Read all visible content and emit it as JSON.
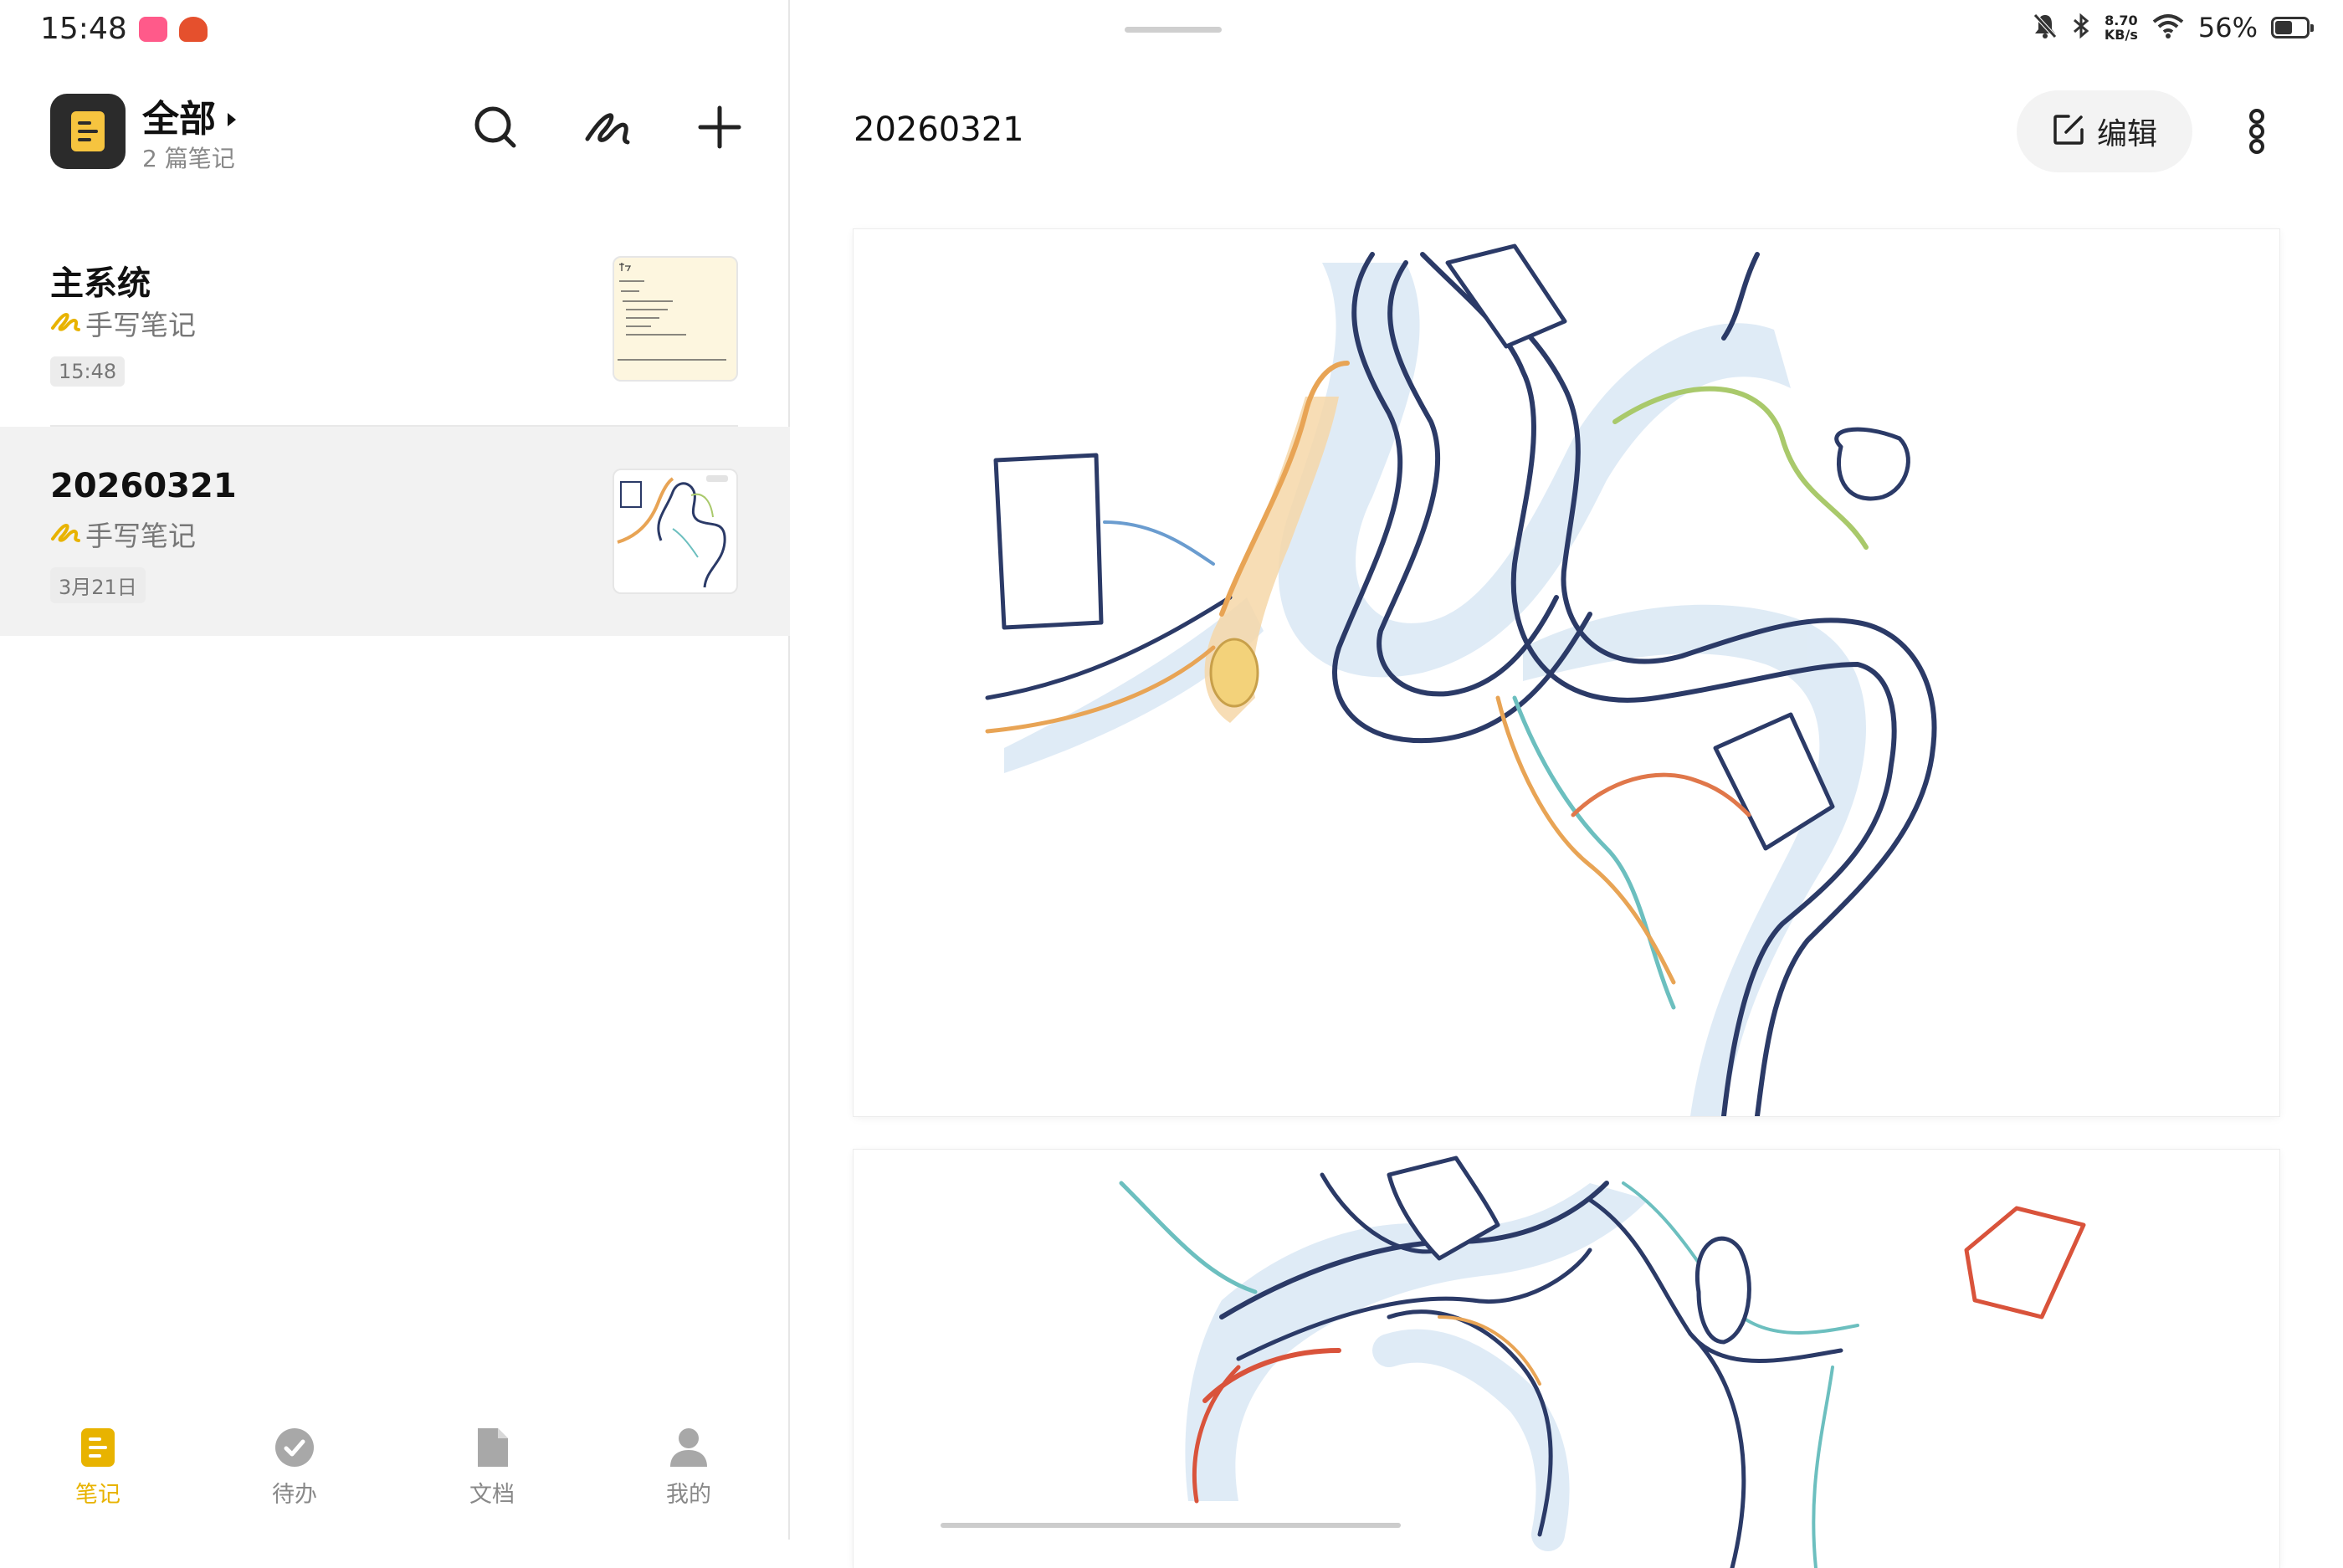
{
  "status_bar": {
    "time": "15:48",
    "net_speed_value": "8.70",
    "net_speed_unit": "KB/s",
    "battery_percent": "56%",
    "battery_level": 0.56
  },
  "sidebar": {
    "folder_title": "全部",
    "folder_count": "2 篇笔记"
  },
  "notes": [
    {
      "title": "主系统",
      "type": "手写笔记",
      "date": "15:48",
      "selected": false
    },
    {
      "title": "20260321",
      "type": "手写笔记",
      "date": "3月21日",
      "selected": true
    }
  ],
  "bottom_nav": [
    {
      "label": "笔记",
      "icon": "note-icon",
      "active": true
    },
    {
      "label": "待办",
      "icon": "todo-check-icon",
      "active": false
    },
    {
      "label": "文档",
      "icon": "document-icon",
      "active": false
    },
    {
      "label": "我的",
      "icon": "profile-icon",
      "active": false
    }
  ],
  "detail": {
    "title": "20260321",
    "edit_label": "编辑"
  },
  "colors": {
    "accent": "#e8b300",
    "selected_row": "#f2f2f2",
    "ink_navy": "#2b3a67",
    "ink_light_blue": "#9cc6e6",
    "ink_orange": "#e8a455",
    "ink_green": "#a9c96b",
    "ink_red": "#d9533b"
  }
}
